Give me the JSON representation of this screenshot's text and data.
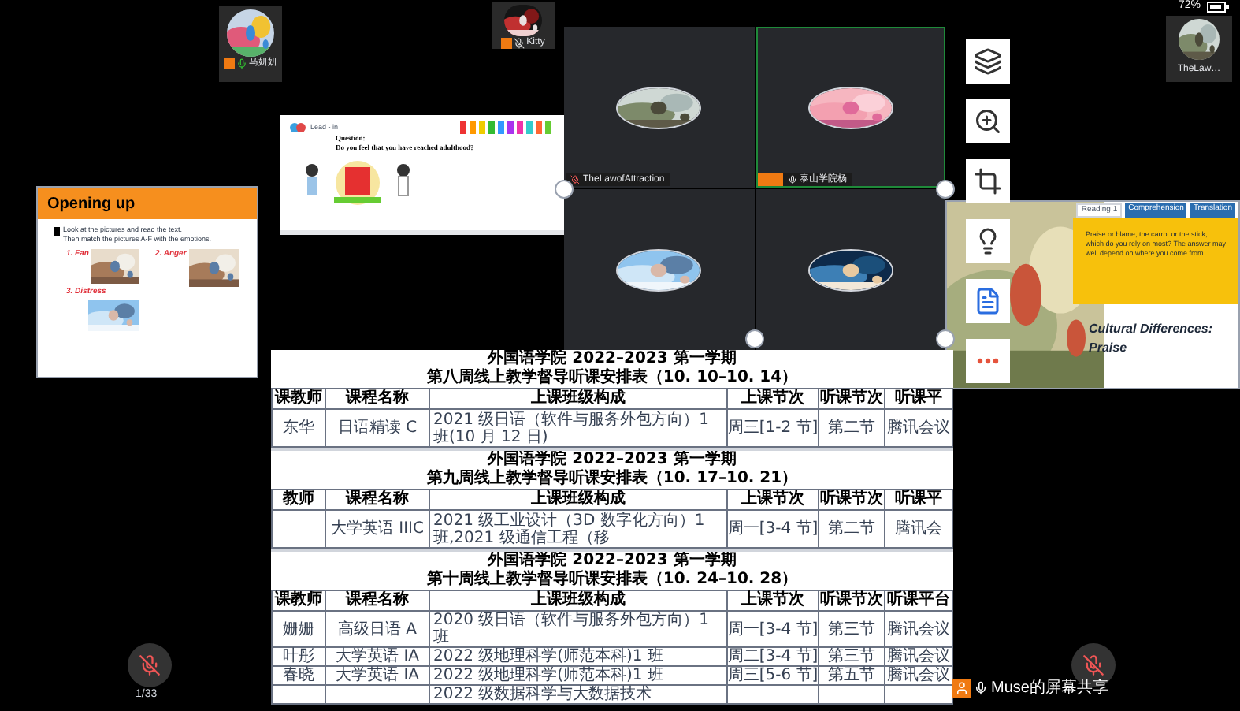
{
  "participants": [
    {
      "name": "马妍妍",
      "host": true,
      "muted": false
    },
    {
      "name": "Kitty",
      "host": true,
      "muted": true
    }
  ],
  "slide_opening": {
    "title": "Opening up",
    "instructions": [
      "Look at the pictures and read the text.",
      "Then match the pictures A-F with the emotions."
    ],
    "labels": [
      "1. Fan",
      "2. Anger",
      "3. Distress"
    ]
  },
  "slide_leadin": {
    "title": "Lead - in",
    "question": "Question:",
    "text": "Do you feel that you have reached adulthood?"
  },
  "video_tiles": [
    {
      "name": "TheLawofAttraction",
      "speaking": false,
      "host": false,
      "muted": true,
      "kind": "landscape"
    },
    {
      "name": "泰山学院杨",
      "speaking": true,
      "host": true,
      "muted": false,
      "kind": "pink"
    },
    {
      "speaking": false,
      "kind": "sky"
    },
    {
      "speaking": false,
      "kind": "nebula"
    }
  ],
  "phone_status": {
    "battery": "72%",
    "user": "TheLaw…"
  },
  "slide_culture": {
    "tabs": [
      {
        "label": "Reading 1",
        "selected": true
      },
      {
        "label": "Comprehension",
        "selected": false
      },
      {
        "label": "Translation",
        "selected": false
      }
    ],
    "text": "Praise or blame, the carrot or the stick, which do you rely on most? The answer may well depend on where you come from.",
    "heading": "Cultural Differences:",
    "subheading": "Praise"
  },
  "tables": [
    {
      "school": "外国语学院 2022–2023 第一学期",
      "title": "第八周线上教学督导听课安排表（10. 10–10. 14）",
      "columns": [
        "课教师",
        "课程名称",
        "上课班级构成",
        "上课节次",
        "听课节次",
        "听课平"
      ],
      "rows": [
        [
          "东华",
          "日语精读 C",
          "2021 级日语（软件与服务外包方向）1 班(10 月 12 日)",
          "周三[1-2 节]",
          "第二节",
          "腾讯会议"
        ]
      ]
    },
    {
      "school": "外国语学院 2022–2023 第一学期",
      "title": "第九周线上教学督导听课安排表（10. 17–10. 21）",
      "columns": [
        "教师",
        "课程名称",
        "上课班级构成",
        "上课节次",
        "听课节次",
        "听课平"
      ],
      "rows": [
        [
          "",
          "大学英语 IIIC",
          "2021 级工业设计（3D 数字化方向）1 班,2021 级通信工程（移",
          "周一[3-4 节]",
          "第二节",
          "腾讯会"
        ]
      ]
    },
    {
      "school": "外国语学院 2022–2023 第一学期",
      "title": "第十周线上教学督导听课安排表（10. 24–10. 28）",
      "columns": [
        "课教师",
        "课程名称",
        "上课班级构成",
        "上课节次",
        "听课节次",
        "听课平台"
      ],
      "rows": [
        [
          "姗姗",
          "高级日语 A",
          "2020 级日语（软件与服务外包方向）1 班",
          "周一[3-4 节]",
          "第三节",
          "腾讯会议"
        ],
        [
          "叶彤",
          "大学英语 IA",
          "2022 级地理科学(师范本科)1 班",
          "周二[3-4 节]",
          "第三节",
          "腾讯会议"
        ],
        [
          "春晓",
          "大学英语 IA",
          "2022 级地理科学(师范本科)1 班",
          "周三[5-6 节]",
          "第五节",
          "腾讯会议"
        ],
        [
          "",
          "",
          "2022 级数据科学与大数据技术",
          "",
          "",
          ""
        ]
      ]
    }
  ],
  "page_counter": "1/33",
  "share_label": "Muse的屏幕共享"
}
